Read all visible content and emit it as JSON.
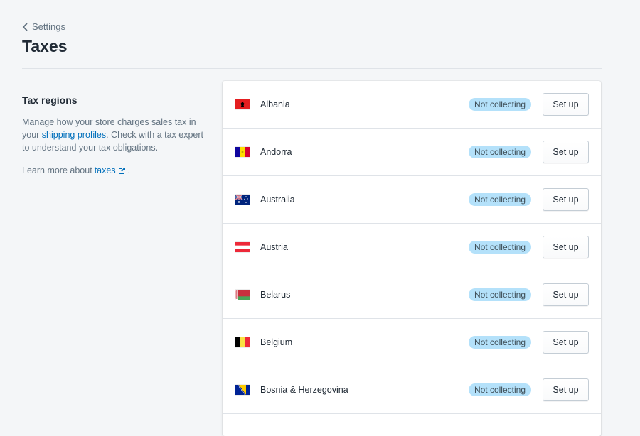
{
  "breadcrumb": {
    "label": "Settings"
  },
  "page": {
    "title": "Taxes"
  },
  "section": {
    "title": "Tax regions",
    "desc_part1": "Manage how your store charges sales tax in your ",
    "desc_link": "shipping profiles",
    "desc_part2": ". Check with a tax expert to understand your tax obligations.",
    "learn_prefix": "Learn more about ",
    "learn_link": "taxes",
    "learn_suffix": "."
  },
  "regions": [
    {
      "name": "Albania",
      "status": "Not collecting",
      "action": "Set up",
      "flag": "albania-flag-icon"
    },
    {
      "name": "Andorra",
      "status": "Not collecting",
      "action": "Set up",
      "flag": "andorra-flag-icon"
    },
    {
      "name": "Australia",
      "status": "Not collecting",
      "action": "Set up",
      "flag": "australia-flag-icon"
    },
    {
      "name": "Austria",
      "status": "Not collecting",
      "action": "Set up",
      "flag": "austria-flag-icon"
    },
    {
      "name": "Belarus",
      "status": "Not collecting",
      "action": "Set up",
      "flag": "belarus-flag-icon"
    },
    {
      "name": "Belgium",
      "status": "Not collecting",
      "action": "Set up",
      "flag": "belgium-flag-icon"
    },
    {
      "name": "Bosnia & Herzegovina",
      "status": "Not collecting",
      "action": "Set up",
      "flag": "bosnia-flag-icon"
    }
  ],
  "colors": {
    "background": "#f4f6f8",
    "link": "#006fbb",
    "badge_bg": "#b4e1fa",
    "text": "#212b36",
    "subdued": "#637381"
  }
}
